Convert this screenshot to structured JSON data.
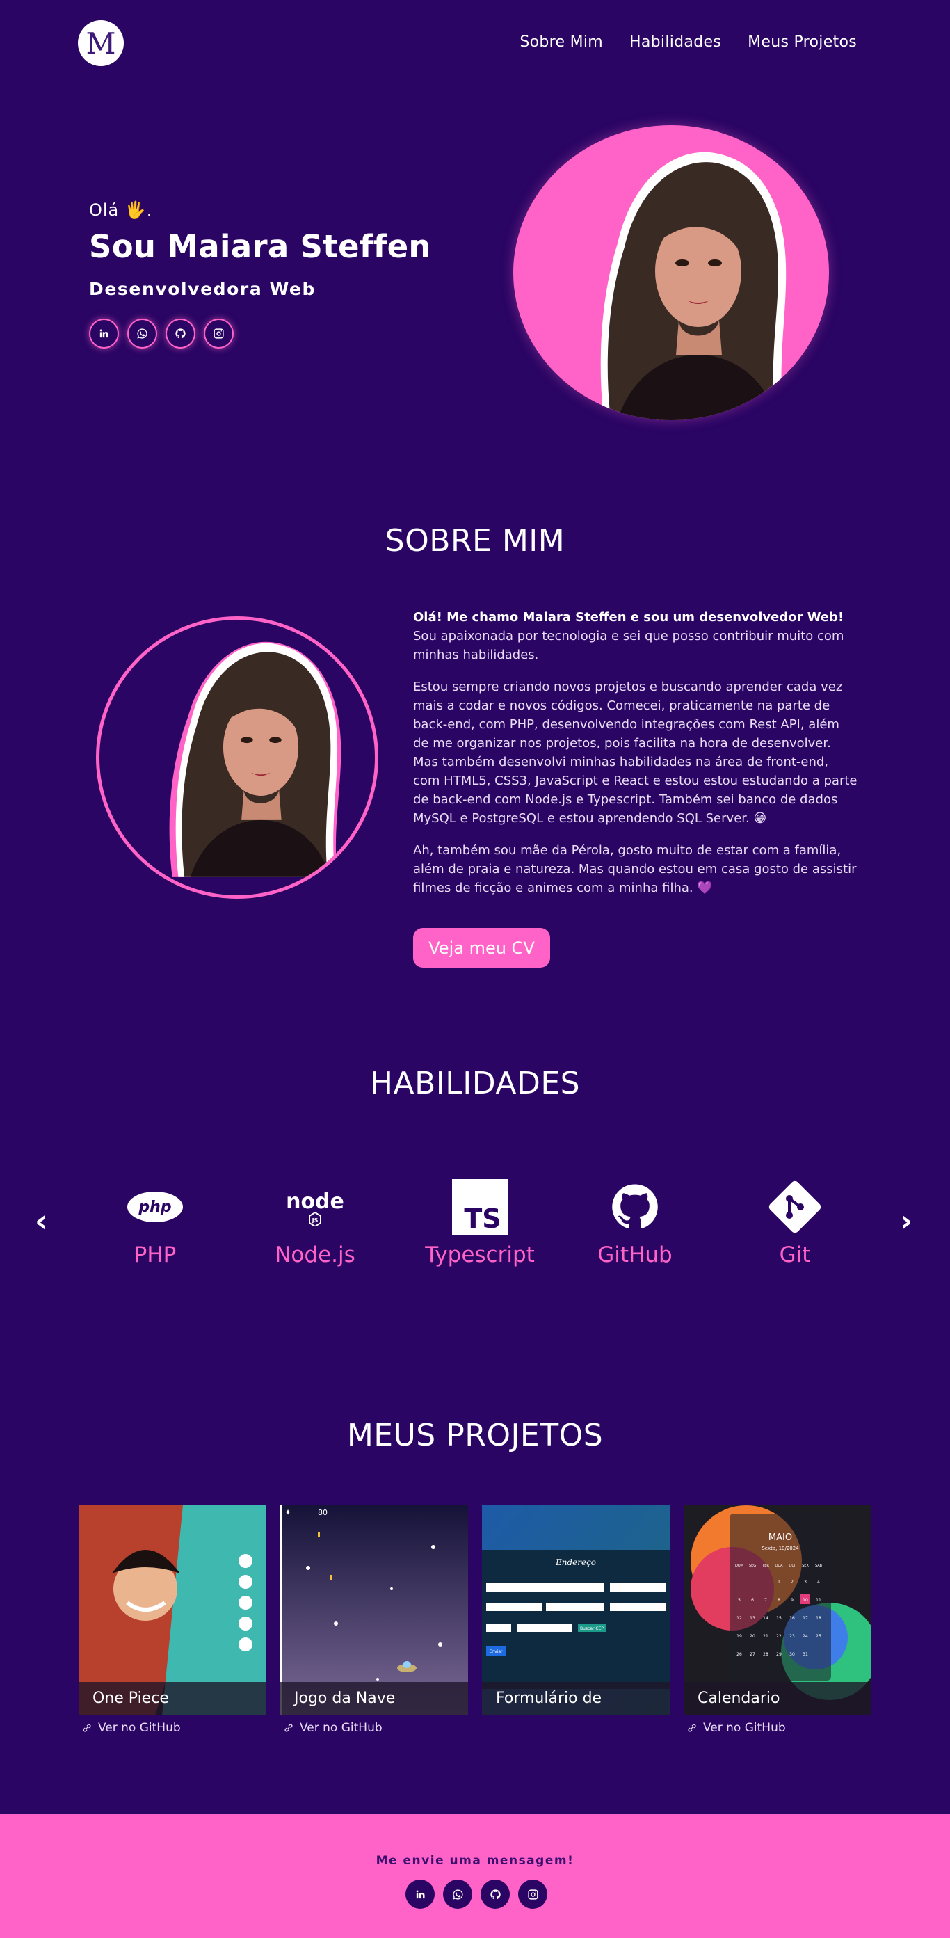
{
  "header": {
    "logo_letter": "M",
    "nav": [
      "Sobre Mim",
      "Habilidades",
      "Meus Projetos"
    ]
  },
  "hero": {
    "greeting": "Olá",
    "greeting_emoji": "🖐",
    "greeting_end": ".",
    "name": "Sou Maiara Steffen",
    "role": "Desenvolvedora Web",
    "social_icons": [
      "linkedin-icon",
      "whatsapp-icon",
      "github-icon",
      "instagram-icon"
    ]
  },
  "about": {
    "title": "SOBRE MIM",
    "intro_bold": "Olá! Me chamo Maiara Steffen e sou um desenvolvedor Web!",
    "intro_rest": " Sou apaixonada por tecnologia e sei que posso contribuir muito com minhas habilidades.",
    "paragraph2": "Estou sempre criando novos projetos e buscando aprender cada vez mais a codar e novos códigos. Comecei, praticamente na parte de back-end, com PHP, desenvolvendo integrações com Rest API, além de me organizar nos projetos, pois facilita na hora de desenvolver. Mas também desenvolvi minhas habilidades na área de front-end, com HTML5, CSS3, JavaScript e React e estou estou estudando a parte de back-end com Node.js e Typescript. Também sei banco de dados MySQL e PostgreSQL e estou aprendendo SQL Server. 😁",
    "paragraph3": "Ah, também sou mãe da Pérola, gosto muito de estar com a família, além de praia e natureza. Mas quando estou em casa gosto de assistir filmes de ficção e animes com a minha filha. 💜",
    "cv_button": "Veja meu CV"
  },
  "skills": {
    "title": "HABILIDADES",
    "prev": "‹",
    "next": "›",
    "items": [
      {
        "label": "PHP",
        "icon": "php-icon"
      },
      {
        "label": "Node.js",
        "icon": "nodejs-icon"
      },
      {
        "label": "Typescript",
        "icon": "typescript-icon"
      },
      {
        "label": "GitHub",
        "icon": "github-icon"
      },
      {
        "label": "Git",
        "icon": "git-icon"
      }
    ]
  },
  "projects": {
    "title": "MEUS PROJETOS",
    "items": [
      {
        "name": "One Piece",
        "link": "Ver no GitHub"
      },
      {
        "name": "Jogo da Nave",
        "link": "Ver no GitHub"
      },
      {
        "name": "Formulário de Endereço",
        "link": ""
      },
      {
        "name": "Calendario",
        "link": "Ver no GitHub"
      }
    ],
    "form_preview": {
      "title": "Endereço",
      "button": "Enviar",
      "search_button": "Buscar CEP"
    },
    "calendar_preview": {
      "month": "MAIO",
      "date": "Sexta, 10/2024",
      "weekdays": [
        "DOM",
        "SEG",
        "TER",
        "QUA",
        "QUI",
        "SEX",
        "SAB"
      ],
      "days": [
        "",
        "",
        "",
        "1",
        "2",
        "3",
        "4",
        "5",
        "6",
        "7",
        "8",
        "9",
        "10",
        "11",
        "12",
        "13",
        "14",
        "15",
        "16",
        "17",
        "18",
        "19",
        "20",
        "21",
        "22",
        "23",
        "24",
        "25",
        "26",
        "27",
        "28",
        "29",
        "30",
        "31",
        "",
        ""
      ],
      "highlight_day": "10"
    },
    "game_preview": {
      "score": "80"
    }
  },
  "footer": {
    "message": "Me envie uma mensagem!",
    "social_icons": [
      "linkedin-icon",
      "whatsapp-icon",
      "github-icon",
      "instagram-icon"
    ]
  },
  "colors": {
    "background": "#2a0563",
    "accent": "#ff63c8"
  }
}
